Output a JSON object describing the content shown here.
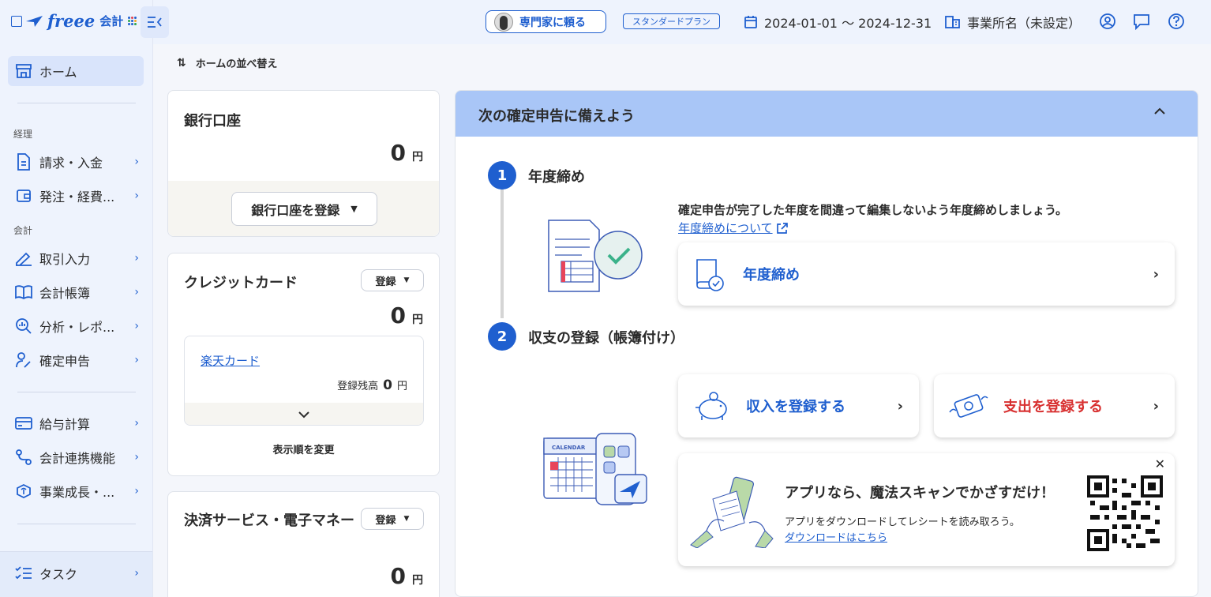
{
  "brand": {
    "name": "freee",
    "product": "会計"
  },
  "sidebar": {
    "home": "ホーム",
    "sections": {
      "accounting_ops": "経理",
      "accounting": "会計"
    },
    "items": {
      "invoice": "請求・入金",
      "expense": "発注・経費...",
      "transactions": "取引入力",
      "books": "会計帳簿",
      "analysis": "分析・レポ...",
      "tax_return": "確定申告",
      "payroll": "給与計算",
      "integrations": "会計連携機能",
      "growth": "事業成長・...",
      "task": "タスク"
    }
  },
  "topbar": {
    "expert": "専門家に頼る",
    "plan": "スタンダードプラン",
    "date_range": "2024-01-01 〜 2024-12-31",
    "office": "事業所名（未設定）"
  },
  "sort_label": "ホームの並べ替え",
  "bank": {
    "title": "銀行口座",
    "amount": "0",
    "unit": "円",
    "register": "銀行口座を登録"
  },
  "credit": {
    "title": "クレジットカード",
    "register": "登録",
    "amount": "0",
    "unit": "円",
    "card_name": "楽天カード",
    "balance_label": "登録残高",
    "balance": "0",
    "balance_unit": "円",
    "change_order": "表示順を変更"
  },
  "payment": {
    "title": "決済サービス・電子マネー",
    "register": "登録",
    "amount": "0",
    "unit": "円"
  },
  "panel": {
    "title": "次の確定申告に備えよう",
    "step1": {
      "num": "1",
      "title": "年度締め",
      "desc": "確定申告が完了した年度を間違って編集しないよう年度締めしましょう。",
      "link": "年度締めについて",
      "button": "年度締め"
    },
    "step2": {
      "num": "2",
      "title": "収支の登録（帳簿付け）",
      "income": "収入を登録する",
      "expense": "支出を登録する"
    },
    "app_promo": {
      "title": "アプリなら、魔法スキャンでかざすだけ！",
      "desc": "アプリをダウンロードしてレシートを読み取ろう。",
      "link": "ダウンロードはこちら"
    },
    "calendar_label": "CALENDAR"
  },
  "colors": {
    "accent": "#1f5fcf",
    "panel_header": "#a9c6f7",
    "expense_red": "#d83131"
  }
}
